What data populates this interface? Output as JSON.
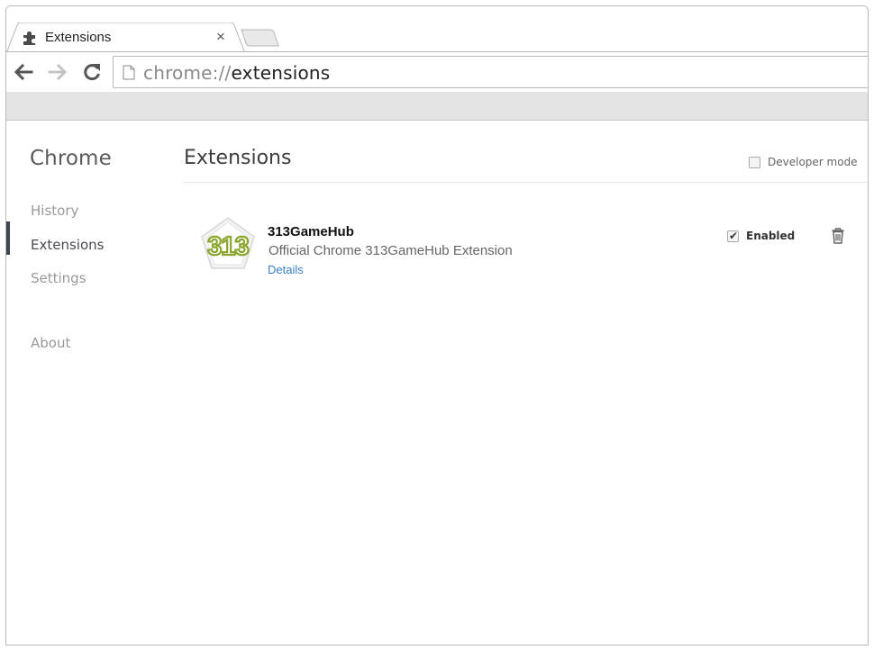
{
  "tab": {
    "title": "Extensions",
    "close_glyph": "×"
  },
  "omnibox": {
    "scheme": "chrome://",
    "host": "extensions"
  },
  "sidebar": {
    "title": "Chrome",
    "items": [
      {
        "label": "History",
        "selected": false
      },
      {
        "label": "Extensions",
        "selected": true
      },
      {
        "label": "Settings",
        "selected": false
      },
      {
        "label": "About",
        "selected": false
      }
    ]
  },
  "main": {
    "title": "Extensions",
    "developer_mode": {
      "label": "Developer mode",
      "checked": false
    }
  },
  "extension": {
    "icon_text": "313",
    "name": "313GameHub",
    "description": "Official Chrome 313GameHub Extension",
    "details_label": "Details",
    "enabled_label": "Enabled",
    "enabled": true
  },
  "colors": {
    "accent_link": "#3a7fc4",
    "sidebar_marker": "#3e4451",
    "icon_green": "#8aa62e"
  },
  "icons": {
    "tab_favicon": "puzzle-piece-icon",
    "back": "arrow-left-icon",
    "forward": "arrow-right-icon",
    "reload": "reload-icon",
    "page": "page-icon",
    "delete": "trash-icon"
  }
}
